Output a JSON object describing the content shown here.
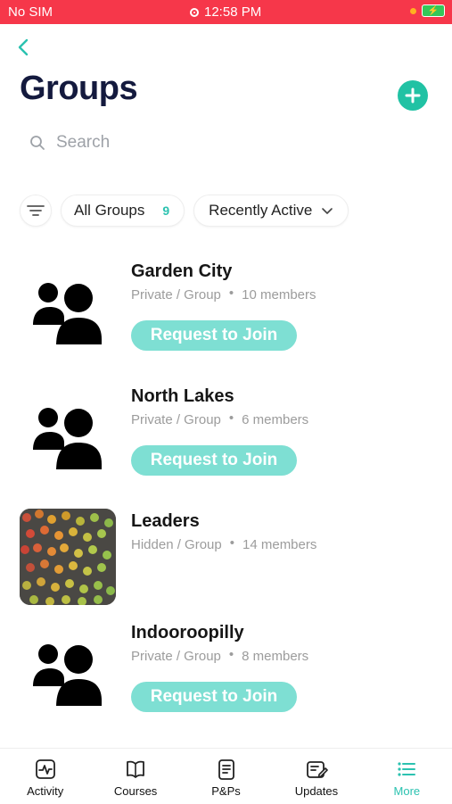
{
  "status_bar": {
    "carrier": "No SIM",
    "time": "12:58 PM"
  },
  "header": {
    "title": "Groups"
  },
  "search": {
    "placeholder": "Search"
  },
  "filters": {
    "all_label": "All Groups",
    "all_count": "9",
    "sort_label": "Recently Active"
  },
  "groups": [
    {
      "name": "Garden City",
      "visibility": "Private / Group",
      "members": "10 members",
      "action": "Request to Join"
    },
    {
      "name": "North Lakes",
      "visibility": "Private / Group",
      "members": "6 members",
      "action": "Request to Join"
    },
    {
      "name": "Leaders",
      "visibility": "Hidden / Group",
      "members": "14 members"
    },
    {
      "name": "Indooroopilly",
      "visibility": "Private / Group",
      "members": "8 members",
      "action": "Request to Join"
    }
  ],
  "tabs": [
    {
      "label": "Activity"
    },
    {
      "label": "Courses"
    },
    {
      "label": "P&Ps"
    },
    {
      "label": "Updates"
    },
    {
      "label": "More"
    }
  ],
  "colors": {
    "accent": "#2bc2b0",
    "status_bar": "#f6374a",
    "join_button": "#7edfd3",
    "title": "#141a3e"
  }
}
